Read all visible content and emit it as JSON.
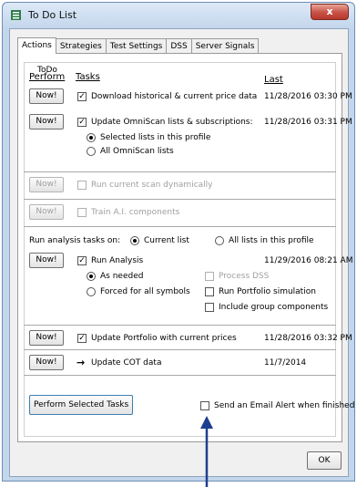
{
  "window": {
    "title": "To Do List",
    "close_glyph": "x",
    "icon": "list-icon"
  },
  "tabs": [
    "Actions",
    "Strategies",
    "Test Settings",
    "DSS",
    "Server Signals"
  ],
  "group": {
    "label": "ToDo"
  },
  "headers": {
    "perform": "Perform",
    "tasks": "Tasks",
    "last": "Last"
  },
  "rows": {
    "download": {
      "button": "Now!",
      "label": "Download historical & current price data",
      "checked": true,
      "last": "11/28/2016 03:30 PM"
    },
    "omniscan": {
      "button": "Now!",
      "label": "Update OmniScan lists & subscriptions:",
      "checked": true,
      "last": "11/28/2016 03:31 PM",
      "options": [
        "Selected lists in this profile",
        "All OmniScan lists"
      ],
      "selected": 0
    },
    "run_scan": {
      "button": "Now!",
      "label": "Run current scan dynamically",
      "checked": false,
      "enabled": false
    },
    "train_ai": {
      "button": "Now!",
      "label": "Train A.I. components",
      "checked": false,
      "enabled": false
    },
    "analysis": {
      "run_on_label": "Run analysis tasks on:",
      "run_on_options": [
        "Current list",
        "All lists in this profile"
      ],
      "run_on_selected": 0,
      "button": "Now!",
      "label": "Run Analysis",
      "checked": true,
      "last": "11/29/2016 08:21 AM",
      "mode_options": [
        "As needed",
        "Forced for all symbols"
      ],
      "mode_selected": 0,
      "extras": [
        {
          "label": "Process DSS",
          "checked": false,
          "enabled": false
        },
        {
          "label": "Run Portfolio simulation",
          "checked": false,
          "enabled": true
        },
        {
          "label": "Include group components",
          "checked": false,
          "enabled": true
        }
      ]
    },
    "portfolio": {
      "button": "Now!",
      "label": "Update Portfolio with current prices",
      "checked": true,
      "last": "11/28/2016 03:32 PM"
    },
    "cot": {
      "button": "Now!",
      "label": "Update COT data",
      "arrow": "→",
      "last": "11/7/2014"
    }
  },
  "footer": {
    "perform_selected": "Perform Selected Tasks",
    "email_alert": "Send an Email Alert when finished",
    "email_checked": false
  },
  "ok_label": "OK",
  "checkmark": "✓",
  "colors": {
    "frame": "#c3d6ec",
    "close": "#c75046",
    "annotation_arrow": "#1d3f8f"
  }
}
